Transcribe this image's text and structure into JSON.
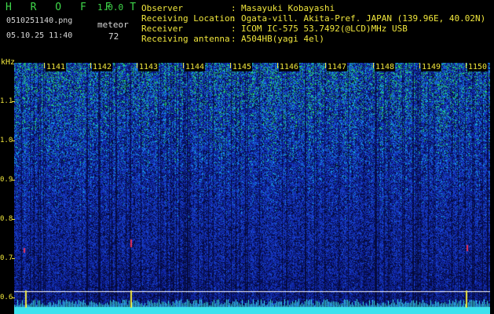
{
  "header": {
    "app_title": "H R O F F T",
    "app_version": "1.0.0",
    "filename": "0510251140.png",
    "datetime": "05.10.25 11:40",
    "meteor_label": "meteor",
    "meteor_count": "72"
  },
  "meta": [
    {
      "key": "Observer",
      "colon": ":",
      "value": "Masayuki Kobayashi"
    },
    {
      "key": "Receiving Location",
      "colon": ":",
      "value": "Ogata-vill. Akita-Pref. JAPAN (139.96E, 40.02N)"
    },
    {
      "key": "Receiver",
      "colon": ":",
      "value": "ICOM IC-575 53.7492(@LCD)MHz USB"
    },
    {
      "key": "Receiving antenna",
      "colon": ":",
      "value": "A504HB(yagi 4el)"
    }
  ],
  "axis": {
    "y_unit": "kHz",
    "y_ticks": [
      "1.1",
      "1.0",
      "0.9",
      "0.8",
      "0.7",
      "0.6"
    ],
    "x_ticks": [
      "1141",
      "1142",
      "1143",
      "1144",
      "1145",
      "1146",
      "1147",
      "1148",
      "1149",
      "1150"
    ]
  },
  "colors": {
    "title_green": "#3fd84a",
    "label_yellow": "#f0e63c",
    "label_white": "#d9d9d9",
    "spectrum_base": "#1636c8",
    "meteor_red": "#e8305a",
    "floor_cyan": "#3ce2ee"
  }
}
